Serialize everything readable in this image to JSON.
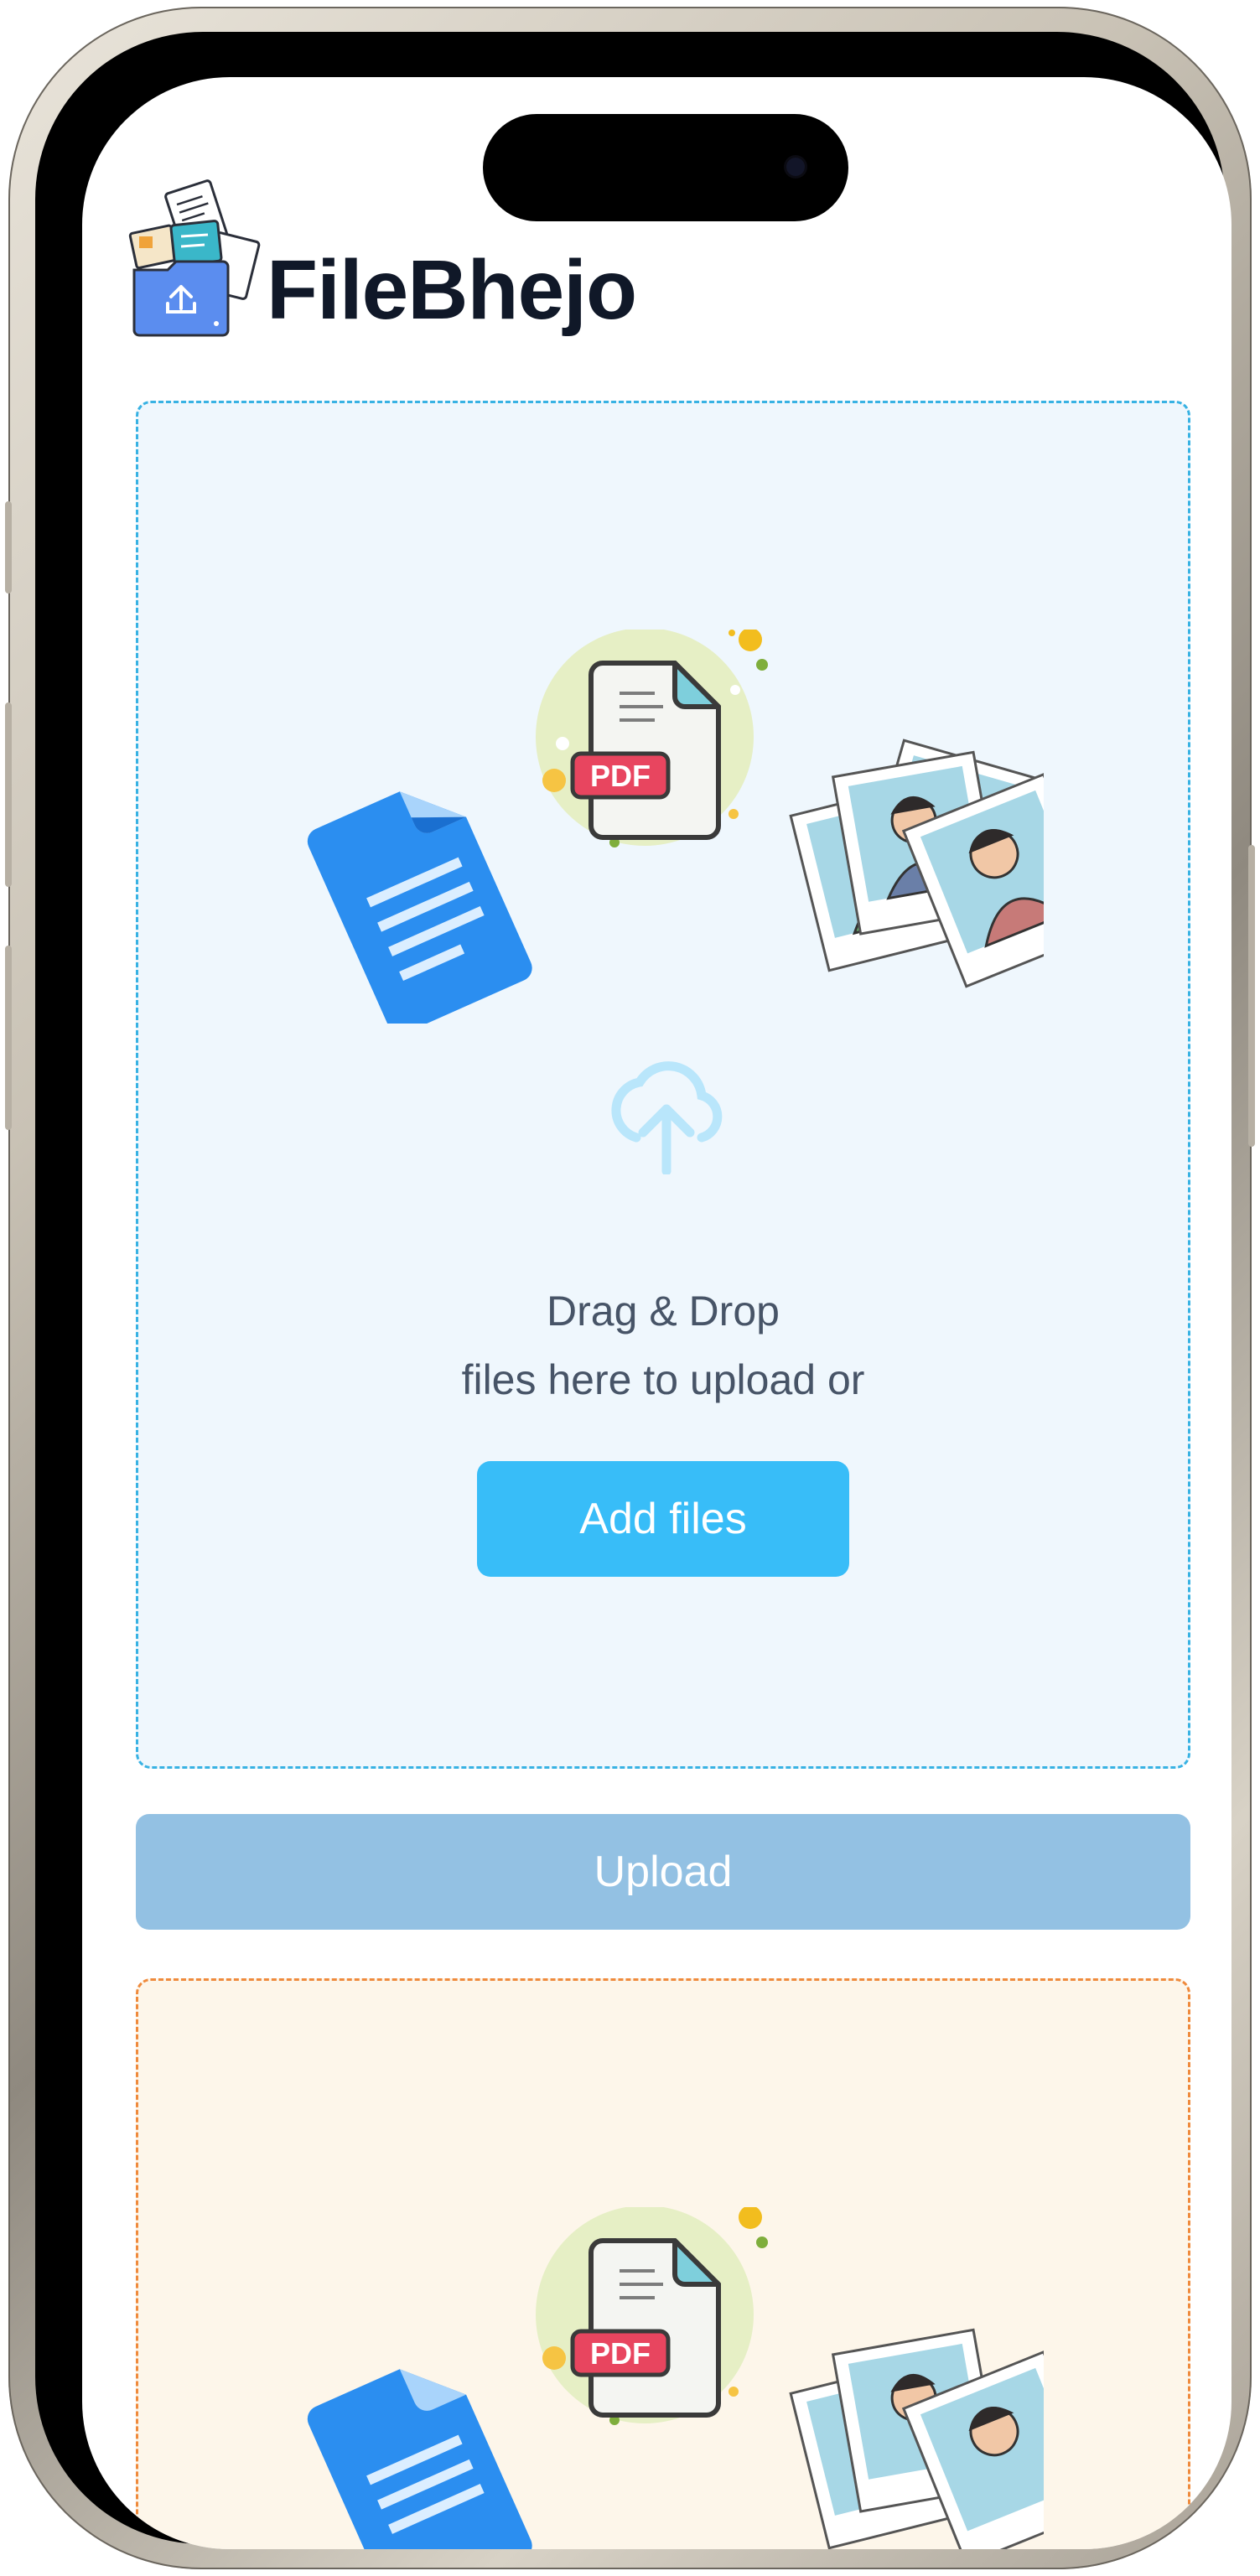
{
  "app": {
    "name": "FileBhejo"
  },
  "dropzone": {
    "line1": "Drag & Drop",
    "line2": "files here to upload or",
    "add_button_label": "Add files",
    "pdf_badge": "PDF"
  },
  "actions": {
    "upload_label": "Upload"
  },
  "secondary_dropzone": {
    "pdf_badge": "PDF"
  },
  "colors": {
    "brand_text": "#101828",
    "primary": "#38bdf8",
    "upload_disabled": "#93c1e3",
    "dropzone_border": "#38b2e3",
    "secondary_border": "#ef8a3c"
  },
  "icons": [
    "app-logo-icon",
    "document-icon",
    "pdf-icon",
    "photos-icon",
    "cloud-upload-icon"
  ]
}
